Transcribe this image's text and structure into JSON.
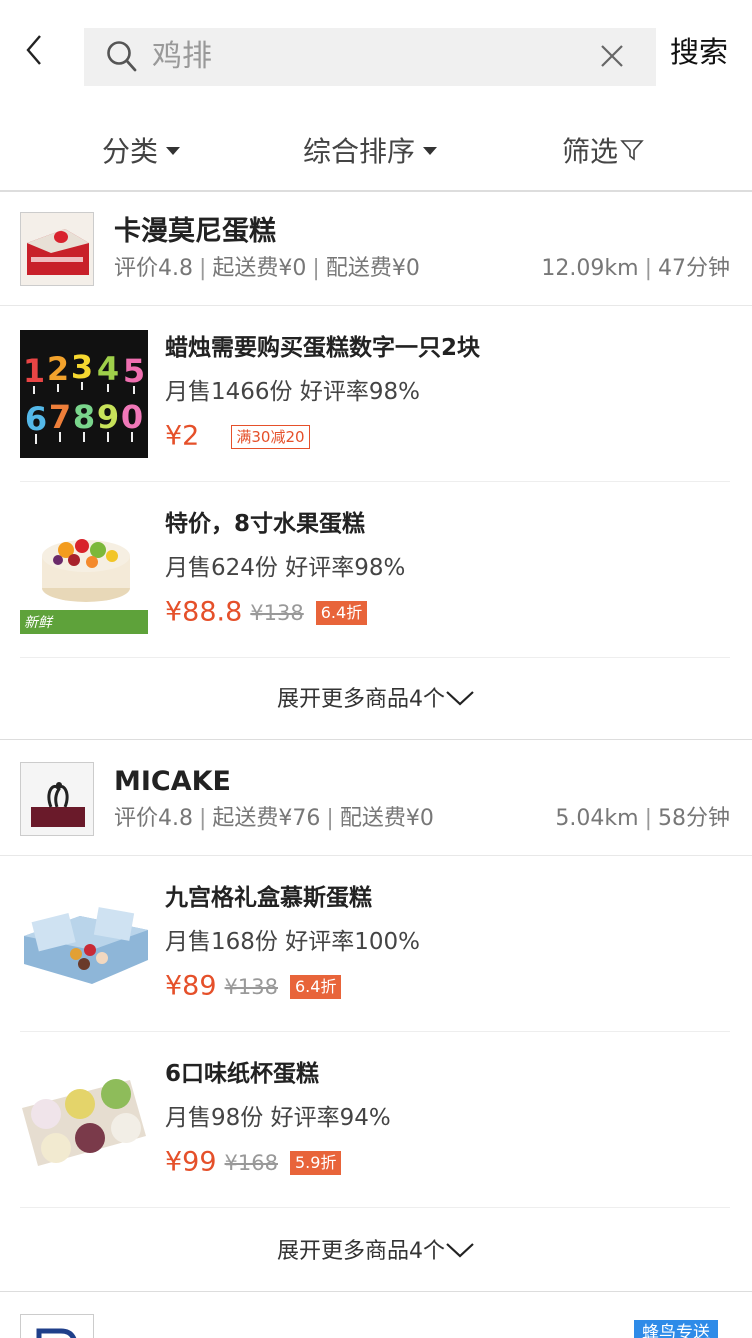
{
  "search": {
    "query": "鸡排",
    "button_label": "搜索"
  },
  "filters": {
    "category": "分类",
    "sort": "综合排序",
    "screen": "筛选"
  },
  "shops": [
    {
      "name": "卡漫莫尼蛋糕",
      "rating": "评价4.8",
      "min_order": "起送费¥0",
      "delivery_fee": "配送费¥0",
      "distance": "12.09km",
      "time": "47分钟",
      "items": [
        {
          "name": "蜡烛需要购买蛋糕数字一只2块",
          "sales": "月售1466份 好评率98%",
          "price": "¥2",
          "original_price": "",
          "promo": "满30减20",
          "discount": ""
        },
        {
          "name": "特价，8寸水果蛋糕",
          "sales": "月售624份 好评率98%",
          "price": "¥88.8",
          "original_price": "¥138",
          "promo": "",
          "discount": "6.4折"
        }
      ],
      "more_label": "展开更多商品4个"
    },
    {
      "name": "MICAKE",
      "rating": "评价4.8",
      "min_order": "起送费¥76",
      "delivery_fee": "配送费¥0",
      "distance": "5.04km",
      "time": "58分钟",
      "items": [
        {
          "name": "九宫格礼盒慕斯蛋糕",
          "sales": "月售168份 好评率100%",
          "price": "¥89",
          "original_price": "¥138",
          "promo": "",
          "discount": "6.4折"
        },
        {
          "name": "6口味纸杯蛋糕",
          "sales": "月售98份 好评率94%",
          "price": "¥99",
          "original_price": "¥168",
          "promo": "",
          "discount": "5.9折"
        }
      ],
      "more_label": "展开更多商品4个"
    }
  ],
  "third_shop": {
    "badge": "蜂鸟专送"
  }
}
